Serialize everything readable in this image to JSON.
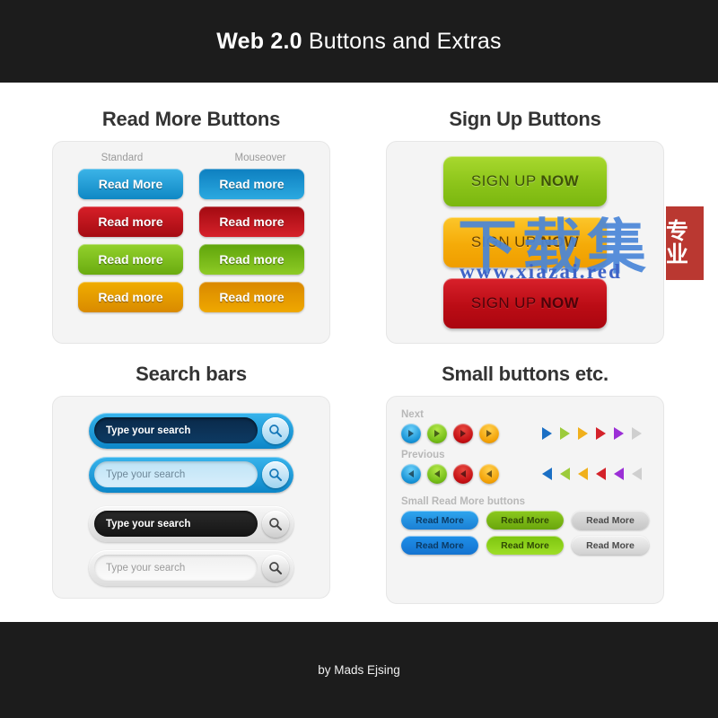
{
  "header": {
    "title_highlight": "Web 2.0",
    "title_rest": " Buttons and Extras"
  },
  "footer": {
    "credit": "by Mads Ejsing"
  },
  "read_more": {
    "section_title": "Read More Buttons",
    "columns": [
      "Standard",
      "Mouseover"
    ],
    "standard": [
      {
        "label": "Read More",
        "color": "#1f9fdc",
        "style": "rm-blue-s"
      },
      {
        "label": "Read more",
        "color": "#c5121a",
        "style": "rm-red-s"
      },
      {
        "label": "Read more",
        "color": "#7fbe1d",
        "style": "rm-green-s"
      },
      {
        "label": "Read more",
        "color": "#e49a00",
        "style": "rm-orange-s"
      }
    ],
    "mouseover": [
      {
        "label": "Read more",
        "color": "#1089c8",
        "style": "rm-blue-m"
      },
      {
        "label": "Read more",
        "color": "#b5151d",
        "style": "rm-red-m"
      },
      {
        "label": "Read more",
        "color": "#74b518",
        "style": "rm-green-m"
      },
      {
        "label": "Read more",
        "color": "#e09100",
        "style": "rm-orange-m"
      }
    ]
  },
  "sign_up": {
    "section_title": "Sign Up Buttons",
    "buttons": [
      {
        "text": "SIGN UP",
        "emphasis": "NOW",
        "color": "#8cc41a",
        "style": "su-green"
      },
      {
        "text": "SIGN UP",
        "emphasis": "NOW",
        "color": "#f5ab08",
        "style": "su-orange"
      },
      {
        "text": "SIGN UP",
        "emphasis": "NOW",
        "color": "#bb0c15",
        "style": "su-red"
      }
    ]
  },
  "watermark": {
    "chinese": "下载集",
    "url": "www.xiazai.red",
    "seal": "专业",
    "blue": "#4a86d8",
    "seal_color": "#b52a22"
  },
  "search": {
    "section_title": "Search bars",
    "bars": [
      {
        "value": "Type your search",
        "style": "sb-1",
        "icon": "search-icon",
        "icon_tone": "blue"
      },
      {
        "value": "Type your search",
        "style": "sb-2",
        "icon": "search-icon",
        "icon_tone": "blue"
      },
      {
        "value": "Type your search",
        "style": "sb-3",
        "icon": "search-icon",
        "icon_tone": "dark"
      },
      {
        "value": "Type your search",
        "style": "sb-4",
        "icon": "search-icon",
        "icon_tone": "dark"
      }
    ]
  },
  "small": {
    "section_title": "Small buttons etc.",
    "next_label": "Next",
    "previous_label": "Previous",
    "small_read_more_label": "Small Read More buttons",
    "circle_colors": [
      {
        "name": "blue",
        "hex": "#1692d6",
        "style": "c-blue"
      },
      {
        "name": "green",
        "hex": "#72bb15",
        "style": "c-green"
      },
      {
        "name": "red",
        "hex": "#c30e12",
        "style": "c-red"
      },
      {
        "name": "orange",
        "hex": "#f2a005",
        "style": "c-orange"
      }
    ],
    "triangle_colors": [
      {
        "name": "blue",
        "hex": "#1b6fc4",
        "style": "t-blue"
      },
      {
        "name": "green",
        "hex": "#9ccb3b",
        "style": "t-green"
      },
      {
        "name": "gold",
        "hex": "#f0b01c",
        "style": "t-gold"
      },
      {
        "name": "red",
        "hex": "#d4222a",
        "style": "t-red"
      },
      {
        "name": "purple",
        "hex": "#9b2fd6",
        "style": "t-purple"
      },
      {
        "name": "gray",
        "hex": "#cfcfcf",
        "style": "t-gray"
      }
    ],
    "small_read_more": [
      [
        {
          "label": "Read More",
          "style": "srm-blue-a"
        },
        {
          "label": "Read More",
          "style": "srm-green-a"
        },
        {
          "label": "Read More",
          "style": "srm-gray-a"
        }
      ],
      [
        {
          "label": "Read More",
          "style": "srm-blue-b"
        },
        {
          "label": "Read More",
          "style": "srm-green-b"
        },
        {
          "label": "Read More",
          "style": "srm-gray-b"
        }
      ]
    ]
  }
}
